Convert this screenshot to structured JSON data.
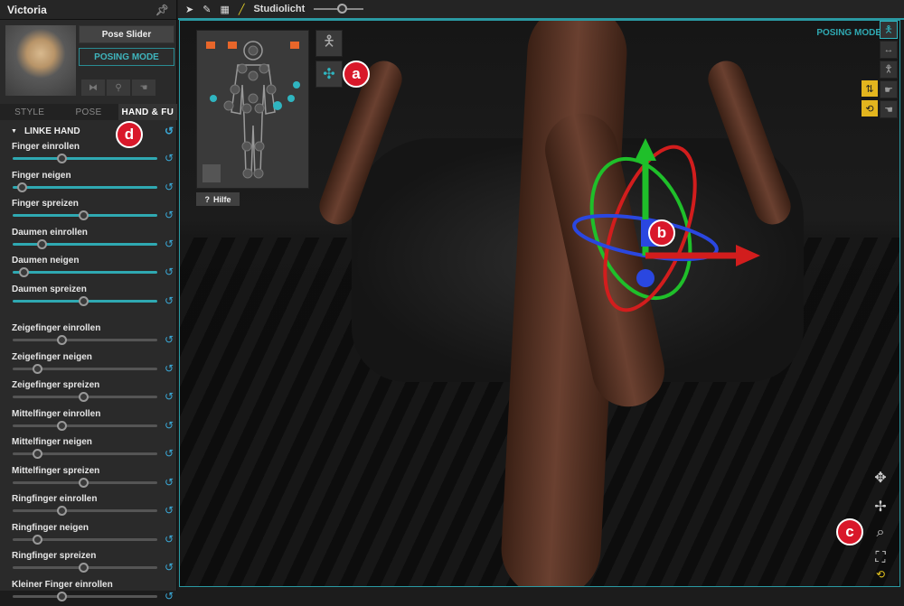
{
  "panel": {
    "title": "Victoria",
    "pose_slider": "Pose Slider",
    "posing_mode": "POSING MODE",
    "tabs": [
      "STYLE",
      "POSE",
      "HAND & FU"
    ],
    "section": "LINKE HAND",
    "sliders_a": [
      {
        "label": "Finger einrollen",
        "value": 0.34
      },
      {
        "label": "Finger neigen",
        "value": 0.06
      },
      {
        "label": "Finger spreizen",
        "value": 0.49
      },
      {
        "label": "Daumen einrollen",
        "value": 0.2
      },
      {
        "label": "Daumen neigen",
        "value": 0.075
      },
      {
        "label": "Daumen spreizen",
        "value": 0.49
      }
    ],
    "sliders_b": [
      {
        "label": "Zeigefinger einrollen",
        "value": 0.34
      },
      {
        "label": "Zeigefinger neigen",
        "value": 0.17
      },
      {
        "label": "Zeigefinger spreizen",
        "value": 0.49
      },
      {
        "label": "Mittelfinger einrollen",
        "value": 0.34
      },
      {
        "label": "Mittelfinger neigen",
        "value": 0.17
      },
      {
        "label": "Mittelfinger spreizen",
        "value": 0.49
      },
      {
        "label": "Ringfinger einrollen",
        "value": 0.34
      },
      {
        "label": "Ringfinger neigen",
        "value": 0.17
      },
      {
        "label": "Ringfinger spreizen",
        "value": 0.49
      },
      {
        "label": "Kleiner Finger einrollen",
        "value": 0.34
      }
    ]
  },
  "toolbar": {
    "light_label": "Studiolicht",
    "light_value": 0.55
  },
  "viewport": {
    "mode_label": "POSING MODE",
    "help": "Hilfe",
    "help_icon": "?"
  },
  "badges": {
    "a": "a",
    "b": "b",
    "c": "c",
    "d": "d"
  }
}
